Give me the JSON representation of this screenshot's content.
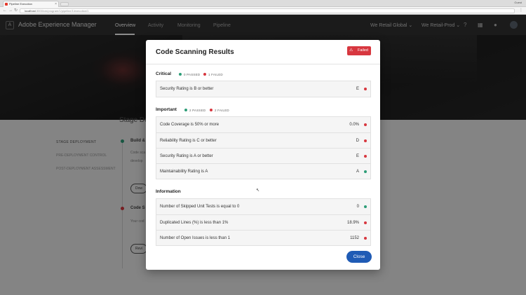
{
  "browser": {
    "tab_title": "Pipeline Execution",
    "tab_close": "×",
    "url_host": "localhost",
    "url_path": ":3000/cm/program/1/pipeline/1/execution/1",
    "user": "Guest"
  },
  "app": {
    "title": "Adobe Experience Manager",
    "logo": "A",
    "nav": [
      "Overview",
      "Activity",
      "Monitoring",
      "Pipeline"
    ],
    "program": "We Retail Global",
    "org": "We Retail-Prod"
  },
  "background": {
    "heading": "Stage De",
    "stage_title": "STAGE DEPLOYMENT",
    "stage_links": [
      "PRE-DEPLOYMENT CONTROL",
      "POST-DEPLOYMENT ASSESSMENT"
    ],
    "steps": [
      {
        "label": "Build &",
        "text": [
          "Code sca",
          "develop"
        ],
        "button": "Dow"
      },
      {
        "label": "Code S",
        "text": [
          "Your cod"
        ],
        "button": "Revi"
      }
    ]
  },
  "modal": {
    "title": "Code Scanning Results",
    "badge": "Failed",
    "close_label": "Close",
    "colors": {
      "pass": "#2d9d78",
      "fail": "#d7373f",
      "badge": "#d7373f",
      "button": "#1f5bb5"
    },
    "sections": {
      "critical": {
        "title": "Critical",
        "passed": "0 PASSED",
        "failed": "1 FAILED",
        "rows": [
          {
            "label": "Security Rating is B or better",
            "value": "E",
            "status": "fail"
          }
        ]
      },
      "important": {
        "title": "Important",
        "passed": "2 PASSED",
        "failed": "2 FAILED",
        "rows": [
          {
            "label": "Code Coverage is 50% or more",
            "value": "0.0%",
            "status": "fail"
          },
          {
            "label": "Reliability Rating is C or better",
            "value": "D",
            "status": "fail"
          },
          {
            "label": "Security Rating is A or better",
            "value": "E",
            "status": "fail"
          },
          {
            "label": "Maintainability Rating is A",
            "value": "A",
            "status": "pass"
          }
        ]
      },
      "information": {
        "title": "Information",
        "rows": [
          {
            "label": "Number of Skipped Unit Tests is equal to 0",
            "value": "0",
            "status": "pass"
          },
          {
            "label": "Duplicated Lines (%) is less than 1%",
            "value": "18.9%",
            "status": "fail"
          },
          {
            "label": "Number of Open Issues is less than 1",
            "value": "1152",
            "status": "fail"
          }
        ]
      }
    }
  }
}
